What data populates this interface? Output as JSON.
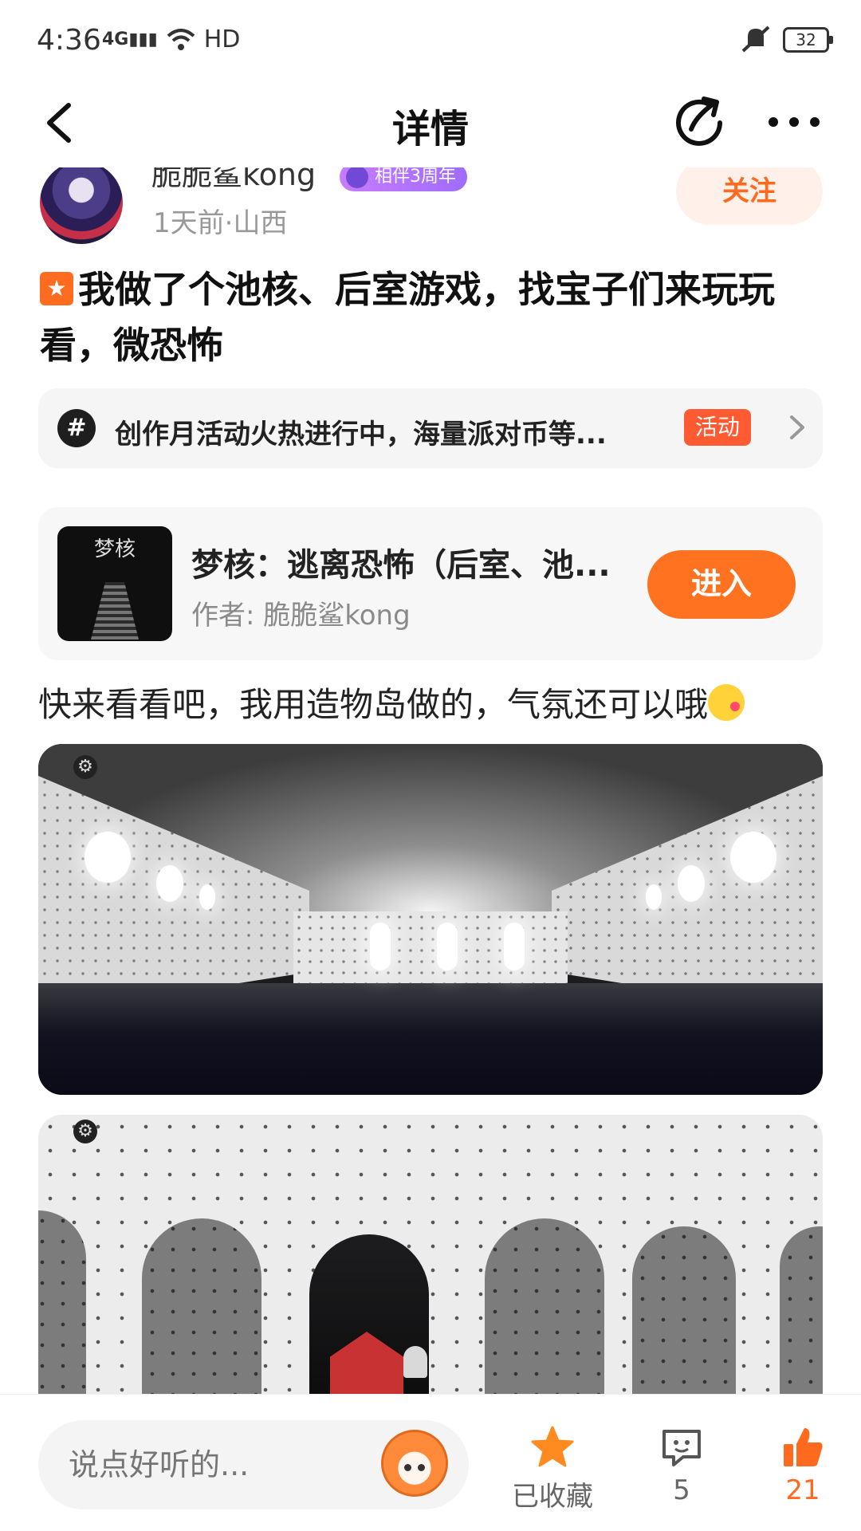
{
  "status_bar": {
    "time": "4:36",
    "network": "4G",
    "wifi": "HD",
    "battery": "32"
  },
  "nav": {
    "title": "详情"
  },
  "author": {
    "name": "脆脆鲨kong",
    "badge": "相伴3周年",
    "meta": "1天前·山西",
    "follow_label": "关注"
  },
  "post": {
    "title": "我做了个池核、后室游戏，找宝子们来玩玩看，微恐怖",
    "body": "快来看看吧，我用造物岛做的，气氛还可以哦"
  },
  "event": {
    "hash": "#",
    "text": "创作月活动火热进行中，海量派对币等...",
    "tag": "活动"
  },
  "game": {
    "thumb_logo": "梦核",
    "title": "梦核：逃离恐怖（后室、池...",
    "author": "作者: 脆脆鲨kong",
    "enter_label": "进入"
  },
  "bottom_bar": {
    "input_placeholder": "说点好听的...",
    "favorite_label": "已收藏",
    "comment_count": "5",
    "like_count": "21"
  },
  "colors": {
    "accent": "#ff7220",
    "follow_bg": "#fff0ea",
    "event_tag": "#ff5a32",
    "badge": "#b57bff"
  },
  "icons": {
    "back": "chevron-left-icon",
    "share": "share-icon",
    "more": "more-icon",
    "topic": "hashtag-icon",
    "arrow": "chevron-right-icon",
    "favorite": "star-icon",
    "comment": "comment-icon",
    "like": "thumbs-up-icon"
  }
}
